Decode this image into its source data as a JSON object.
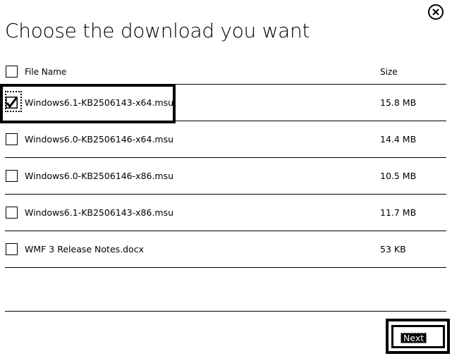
{
  "dialog": {
    "title": "Choose the download you want",
    "close_icon": "close-circle-icon"
  },
  "table": {
    "headers": {
      "file_name": "File Name",
      "size": "Size"
    },
    "rows": [
      {
        "name": "Windows6.1-KB2506143-x64.msu",
        "size": "15.8 MB",
        "checked": true
      },
      {
        "name": "Windows6.0-KB2506146-x64.msu",
        "size": "14.4 MB",
        "checked": false
      },
      {
        "name": "Windows6.0-KB2506146-x86.msu",
        "size": "10.5 MB",
        "checked": false
      },
      {
        "name": "Windows6.1-KB2506143-x86.msu",
        "size": "11.7 MB",
        "checked": false
      },
      {
        "name": "WMF 3 Release Notes.docx",
        "size": "53 KB",
        "checked": false
      }
    ]
  },
  "footer": {
    "next_label": "Next"
  }
}
